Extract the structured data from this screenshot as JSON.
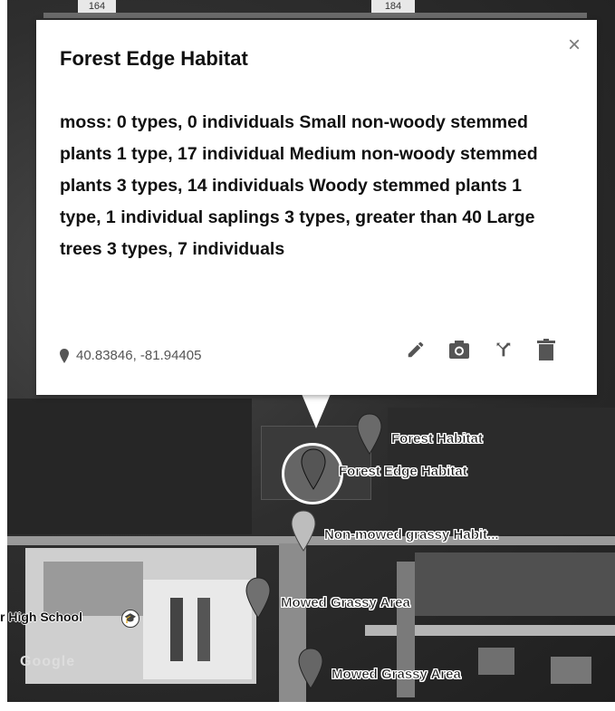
{
  "map": {
    "road_labels": [
      "164",
      "184"
    ],
    "school_label": "r High School",
    "google_mark": "Google",
    "markers": [
      {
        "label": "Forest Habitat",
        "color": "#6a6a6a"
      },
      {
        "label": "Forest Edge Habitat",
        "color": "#555555"
      },
      {
        "label": "Non-mowed grassy Habit...",
        "color": "#bdbdbd"
      },
      {
        "label": "Mowed Grassy Area",
        "color": "#707070"
      },
      {
        "label": "Mowed Grassy Area",
        "color": "#666666"
      }
    ]
  },
  "popup": {
    "title": "Forest Edge Habitat",
    "close_icon": "×",
    "description": "moss: 0 types, 0 individuals Small non-woody stemmed plants 1 type, 17 individual Medium non-woody stemmed plants 3 types, 14 individuals Woody stemmed plants 1 type, 1 individual saplings 3 types, greater than 40 Large trees 3 types, 7 individuals",
    "coordinates": "40.83846, -81.94405",
    "actions": [
      "edit-icon",
      "camera-icon",
      "merge-icon",
      "trash-icon"
    ]
  }
}
